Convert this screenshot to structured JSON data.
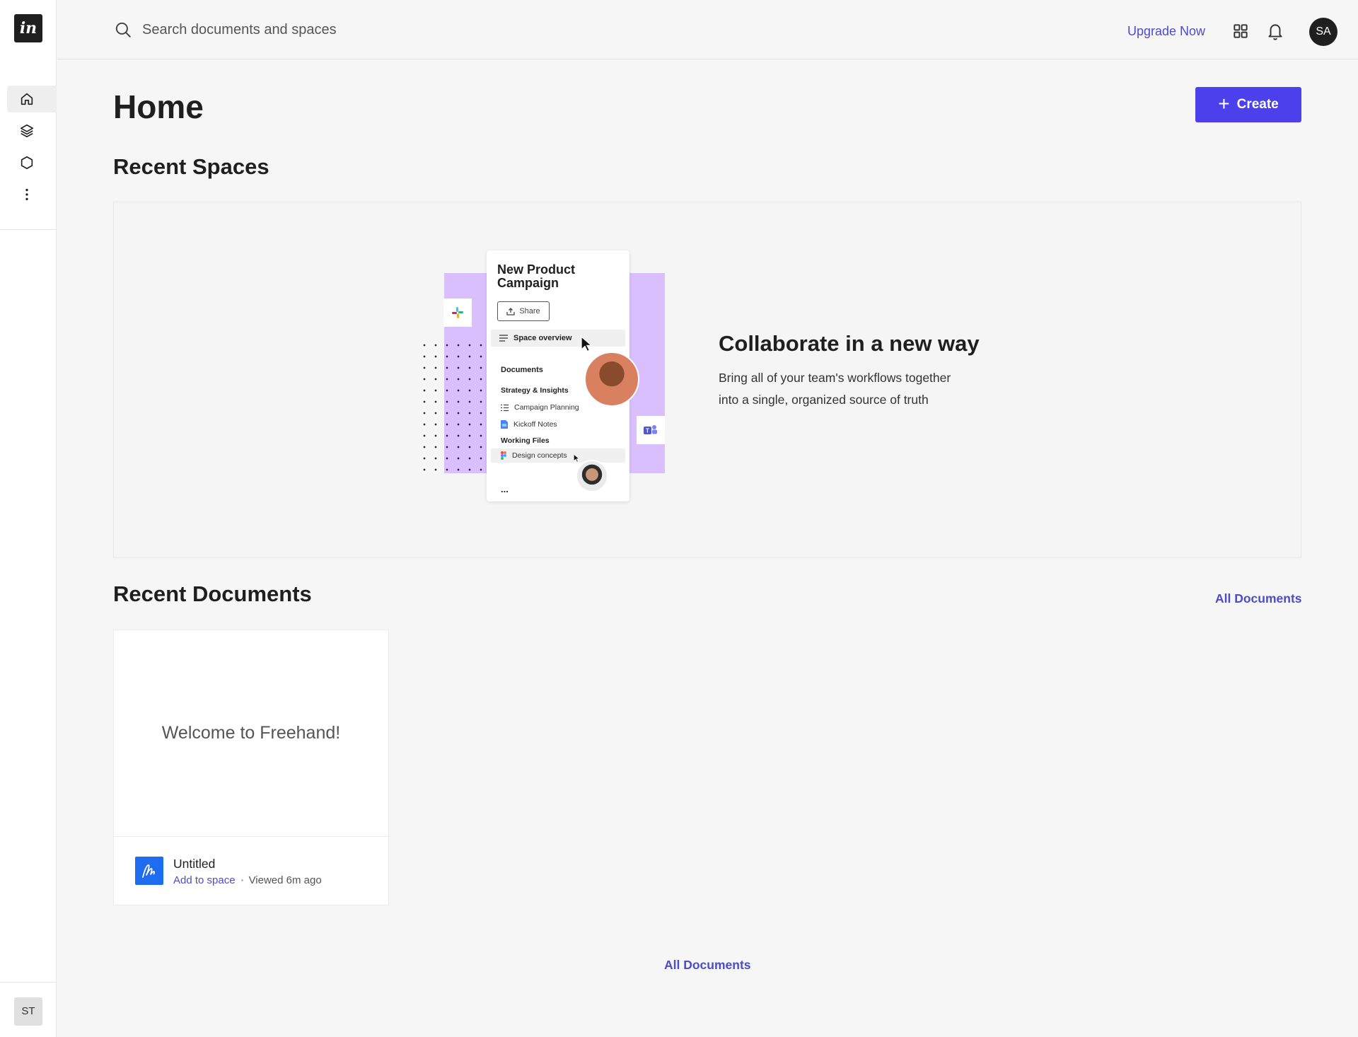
{
  "sidebar": {
    "logo_text": "in",
    "user_initials": "ST",
    "nav_items": [
      "home-icon",
      "layers-icon",
      "hexagon-icon",
      "more-vertical-icon"
    ]
  },
  "topbar": {
    "search_placeholder": "Search documents and spaces",
    "upgrade_label": "Upgrade Now",
    "avatar_initials": "SA"
  },
  "main": {
    "title": "Home",
    "create_label": "Create",
    "recent_spaces_title": "Recent Spaces",
    "recent_documents_title": "Recent Documents",
    "all_documents_label": "All Documents"
  },
  "promo": {
    "heading": "Collaborate in a new way",
    "description": "Bring all of your team's workflows together into a single, organized source of truth",
    "mock": {
      "title": "New Product Campaign",
      "share": "Share",
      "overview": "Space overview",
      "documents": "Documents",
      "strategy": "Strategy & Insights",
      "campaign_planning": "Campaign Planning",
      "kickoff_notes": "Kickoff Notes",
      "working_files": "Working Files",
      "design_concepts": "Design concepts",
      "more": "..."
    }
  },
  "documents": [
    {
      "preview_text": "Welcome to Freehand!",
      "name": "Untitled",
      "add_to_space": "Add to space",
      "viewed": "Viewed 6m ago"
    }
  ],
  "colors": {
    "accent": "#4b40ec",
    "link": "#4c4cc9",
    "illustration_purple": "#d9bffd",
    "doc_icon_blue": "#1e6cf0"
  }
}
